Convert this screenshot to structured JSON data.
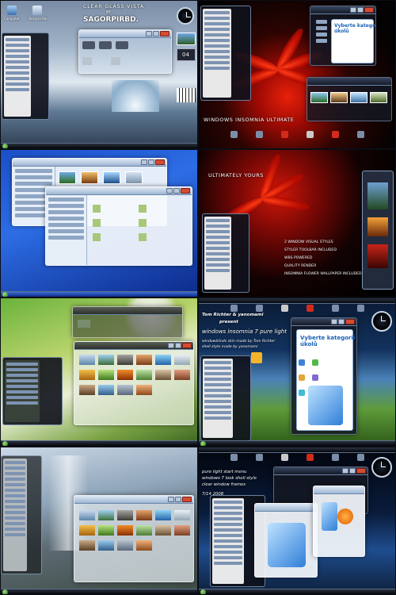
{
  "panel1": {
    "desktop_icons": [
      "Computer",
      "Recycle Bin"
    ],
    "banner_line1": "CLEAR GLASS VISTA",
    "banner_line2": "BY",
    "banner_line3": "SAGORPIRBD.",
    "gadget_number": "04"
  },
  "panel2": {
    "heading": "WINDOWS INSOMNIA ULTIMATE",
    "category_prompt_line1": "Vyberte kategorii",
    "category_prompt_line2": "úkolů"
  },
  "panel4": {
    "heading": "ULTIMATELY YOURS",
    "feature_lines": [
      "2 WINDOW VISUAL STYLES",
      "STYLER TOOLBAR INCLUDED",
      "WBS POWERED",
      "QUALITY RENDER",
      "INSOMNIA FLOWER WALLPAPER INCLUDED"
    ]
  },
  "panel6": {
    "credits_line1": "Tom Richter & yanomami",
    "credits_line2": "present",
    "title": "windows insomnia 7 pure light",
    "sub_line1": "windowblinds skin made by Tom Richter",
    "sub_line2": "shell style made by yanomami",
    "category_prompt_line1": "Vyberte kategorii",
    "category_prompt_line2": "úkolů"
  },
  "panel8": {
    "line1": "pure light start menu",
    "line2": "windows 7 look shell style",
    "line3": "clear window frames",
    "date": "7/14 2008"
  },
  "colors": {
    "accent_blue": "#1b63b8",
    "flower_red": "#e8200a",
    "close_button": "#d54b33"
  }
}
